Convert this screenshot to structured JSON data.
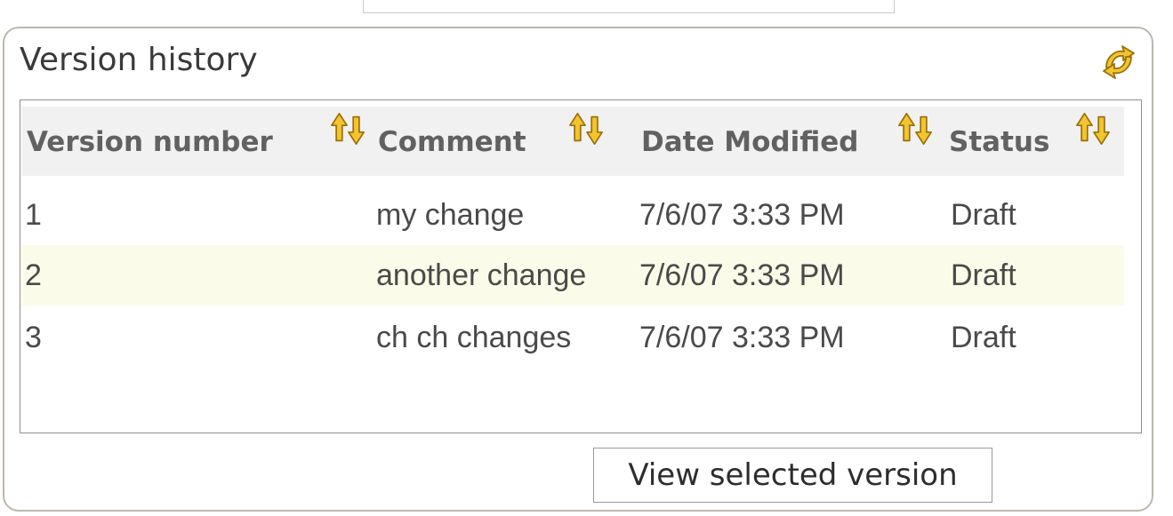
{
  "panel": {
    "title": "Version history",
    "refresh_icon": "refresh-arrows-icon"
  },
  "table": {
    "columns": [
      {
        "label": "Version number",
        "sort_icon": "sort-arrows-icon"
      },
      {
        "label": "Comment",
        "sort_icon": "sort-arrows-icon"
      },
      {
        "label": "Date Modified",
        "sort_icon": "sort-arrows-icon"
      },
      {
        "label": "Status",
        "sort_icon": "sort-arrows-icon"
      }
    ],
    "rows": [
      {
        "version": "1",
        "comment": "my change",
        "date": "7/6/07 3:33 PM",
        "status": "Draft"
      },
      {
        "version": "2",
        "comment": "another change",
        "date": "7/6/07 3:33 PM",
        "status": "Draft"
      },
      {
        "version": "3",
        "comment": "ch ch changes",
        "date": "7/6/07 3:33 PM",
        "status": "Draft"
      }
    ]
  },
  "actions": {
    "view_selected_label": "View selected version"
  },
  "colors": {
    "icon_gold": "#e8b41c",
    "icon_gold_dark": "#a87a08",
    "alt_row": "#fbfbe9",
    "header_bg": "#f1f1f1",
    "panel_border": "#bdb8ad"
  }
}
